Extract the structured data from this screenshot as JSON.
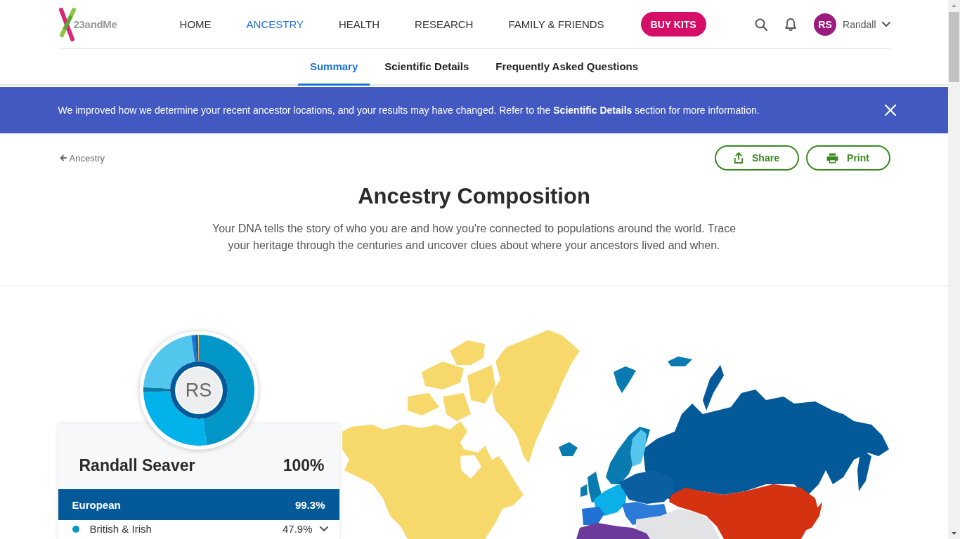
{
  "header": {
    "logo_text": "23andMe",
    "nav": [
      {
        "label": "HOME",
        "selected": false
      },
      {
        "label": "ANCESTRY",
        "selected": true
      },
      {
        "label": "HEALTH",
        "selected": false
      },
      {
        "label": "RESEARCH",
        "selected": false
      },
      {
        "label": "FAMILY & FRIENDS",
        "selected": false
      }
    ],
    "buy_button": "BUY KITS",
    "user": {
      "initials": "RS",
      "name": "Randall"
    }
  },
  "subtabs": [
    {
      "label": "Summary",
      "selected": true
    },
    {
      "label": "Scientific Details",
      "selected": false
    },
    {
      "label": "Frequently Asked Questions",
      "selected": false
    }
  ],
  "banner": {
    "text": "We improved how we determine your recent ancestor locations, and your results may have changed. Refer to the **Scientific Details** section for more information."
  },
  "back_link": "Ancestry",
  "actions": [
    {
      "kind": "share",
      "label": "Share"
    },
    {
      "kind": "print",
      "label": "Print"
    }
  ],
  "title": "Ancestry Composition",
  "intro": "Your DNA tells the story of who you are and how you're connected to populations around the world. Trace your heritage through the centuries and uncover clues about where your ancestors lived and when.",
  "composition": {
    "initials": "RS",
    "name": "Randall Seaver",
    "total": "100%",
    "group": {
      "name": "European",
      "percent": "99.3%"
    },
    "populations": [
      {
        "name": "British & Irish",
        "percent": "47.9%",
        "color": "#0597c9"
      }
    ]
  }
}
